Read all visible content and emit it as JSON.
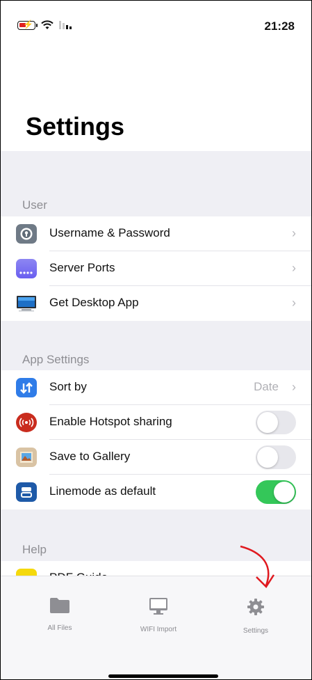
{
  "status_bar": {
    "time": "21:28"
  },
  "page": {
    "title": "Settings"
  },
  "sections": {
    "user": {
      "label": "User",
      "items": [
        {
          "label": "Username & Password",
          "icon": "key-lock-icon"
        },
        {
          "label": "Server Ports",
          "icon": "server-ports-icon"
        },
        {
          "label": "Get Desktop App",
          "icon": "desktop-monitor-icon"
        }
      ]
    },
    "app_settings": {
      "label": "App Settings",
      "items": [
        {
          "label": "Sort by",
          "value": "Date",
          "icon": "sort-arrows-icon"
        },
        {
          "label": "Enable Hotspot sharing",
          "toggle": false,
          "icon": "hotspot-icon"
        },
        {
          "label": "Save to Gallery",
          "toggle": false,
          "icon": "gallery-icon"
        },
        {
          "label": "Linemode as default",
          "toggle": true,
          "icon": "linemode-icon"
        }
      ]
    },
    "help": {
      "label": "Help",
      "items": [
        {
          "label": "PDF Guide",
          "icon": "pdf-guide-icon"
        }
      ]
    }
  },
  "tab_bar": {
    "tabs": [
      {
        "label": "All Files",
        "icon": "folder-icon"
      },
      {
        "label": "WIFI Import",
        "icon": "monitor-icon"
      },
      {
        "label": "Settings",
        "icon": "gear-icon"
      }
    ]
  },
  "colors": {
    "toggle_on": "#34c759",
    "toggle_off": "#e7e7ec",
    "section_label": "#8e8e93",
    "annotation_arrow": "#e0191f"
  }
}
